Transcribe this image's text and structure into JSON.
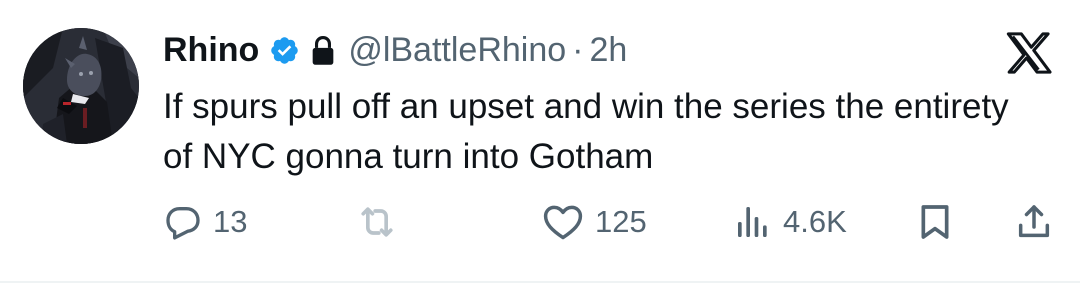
{
  "tweet": {
    "display_name": "Rhino",
    "handle": "@lBattleRhino",
    "separator": "·",
    "time": "2h",
    "text": "If spurs pull off an upset and win the series the entirety of NYC gonna turn into Gotham",
    "verified_color": "#1d9bf0",
    "icons": {
      "verified": "verified-badge-icon",
      "protected": "lock-icon",
      "brand": "x-logo-icon"
    }
  },
  "actions": {
    "reply": {
      "icon": "reply-icon",
      "count": "13"
    },
    "retweet": {
      "icon": "retweet-icon",
      "count": ""
    },
    "like": {
      "icon": "heart-icon",
      "count": "125"
    },
    "views": {
      "icon": "views-icon",
      "count": "4.6K"
    },
    "bookmark": {
      "icon": "bookmark-icon"
    },
    "share": {
      "icon": "share-icon"
    }
  },
  "colors": {
    "text_primary": "#0f1419",
    "text_secondary": "#536471",
    "retweet_muted": "#b9c3ca"
  }
}
